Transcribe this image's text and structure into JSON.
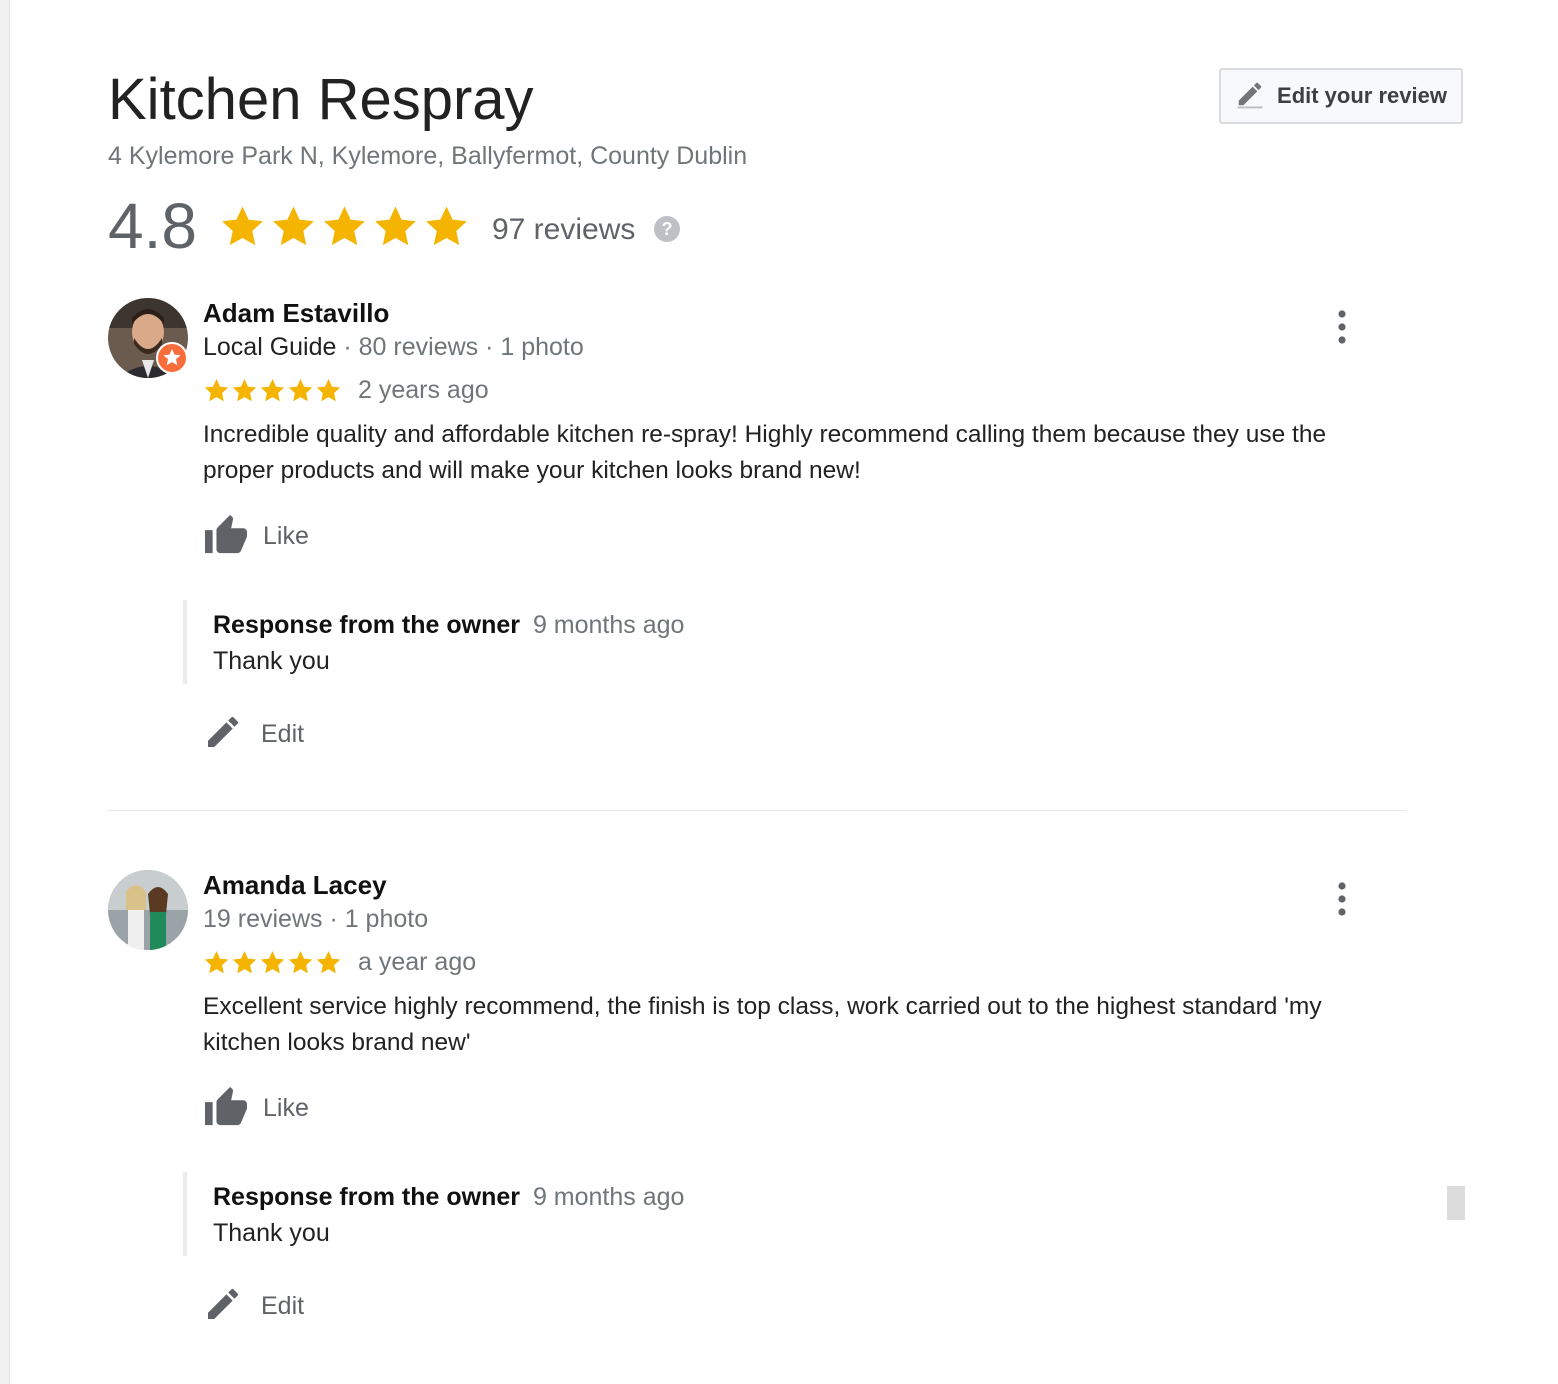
{
  "place": {
    "name": "Kitchen Respray",
    "address": "4 Kylemore Park N, Kylemore, Ballyfermot, County Dublin",
    "rating": "4.8",
    "stars": 5,
    "review_count": "97 reviews"
  },
  "edit_review_button": {
    "label": "Edit your review",
    "icon": "pencil-icon"
  },
  "reviews": [
    {
      "name": "Adam Estavillo",
      "guide_label": "Local Guide",
      "meta": " · 80 reviews · 1 photo",
      "stars": 5,
      "time": "2 years ago",
      "text": "Incredible quality and affordable kitchen re-spray! Highly recommend calling them because they use the proper products and will make your kitchen looks brand new!",
      "like_label": "Like",
      "response": {
        "title": "Response from the owner",
        "time": "9 months ago",
        "text": "Thank you"
      },
      "edit_label": "Edit"
    },
    {
      "name": "Amanda Lacey",
      "meta": "19 reviews · 1 photo",
      "stars": 5,
      "time": "a year ago",
      "text": "Excellent service highly recommend, the finish is top class, work carried out to the highest standard 'my kitchen looks brand new'",
      "like_label": "Like",
      "response": {
        "title": "Response from the owner",
        "time": "9 months ago",
        "text": "Thank you"
      },
      "edit_label": "Edit"
    }
  ],
  "colors": {
    "star": "#f4b400",
    "badge": "#f96c3c",
    "muted": "#70757a"
  }
}
